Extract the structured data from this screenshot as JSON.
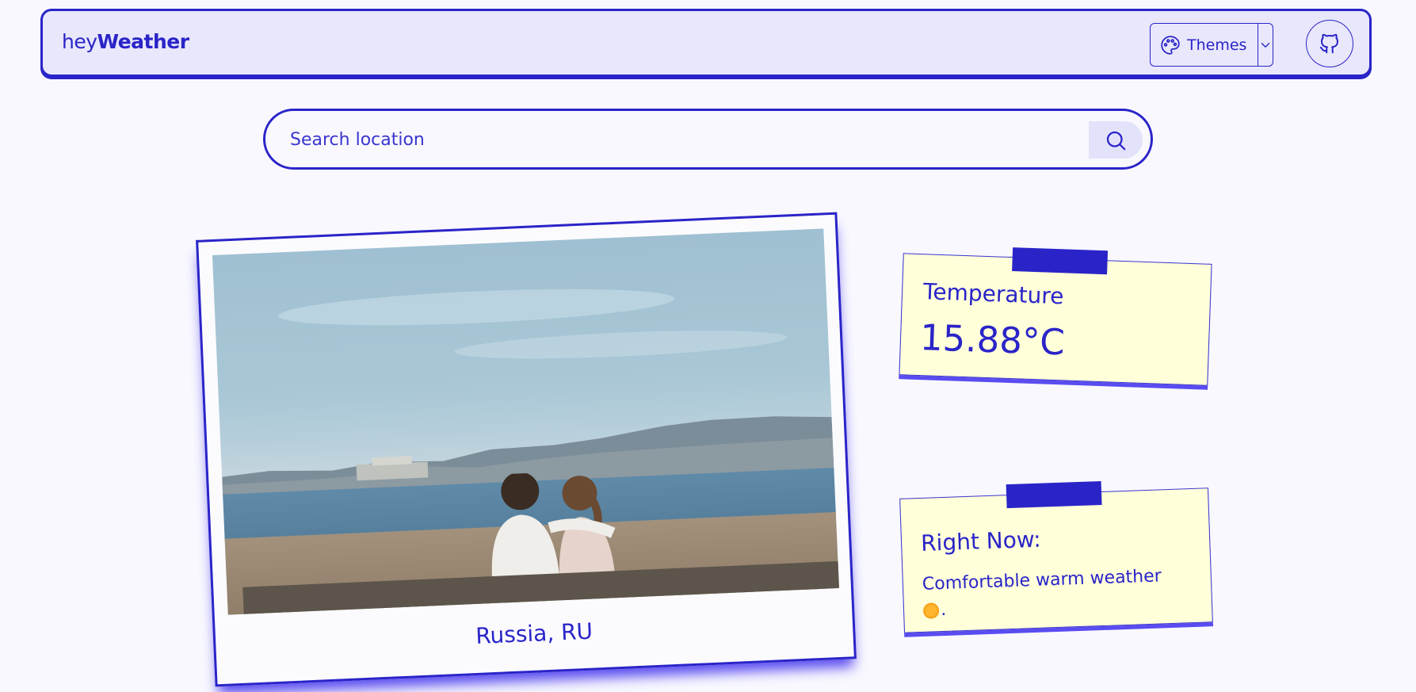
{
  "navbar": {
    "brand_prefix": "hey",
    "brand_suffix": "Weather",
    "themes_label": "Themes",
    "themes_icon": "palette-icon",
    "caret_icon": "chevron-down-icon",
    "github_icon": "github-icon"
  },
  "search": {
    "placeholder": "Search location",
    "value": "",
    "icon": "search-icon"
  },
  "location_card": {
    "caption": "Russia, RU"
  },
  "temperature_note": {
    "label": "Temperature",
    "value": "15.88°C"
  },
  "right_now_note": {
    "label": "Right Now:",
    "description": "Comfortable warm weather",
    "emoji_icon": "sun-emoji-icon",
    "trailing": "."
  },
  "colors": {
    "accent": "#2a24c8",
    "navbar_bg": "#e8e7fb",
    "page_bg": "#f8f8fe",
    "note_bg": "#ffffda"
  }
}
